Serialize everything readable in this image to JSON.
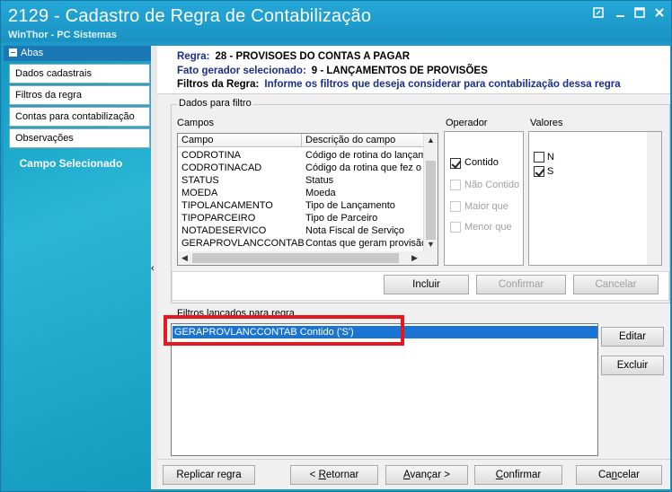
{
  "window": {
    "title": "2129 - Cadastro de Regra de Contabilização",
    "subtitle": "WinThor - PC Sistemas"
  },
  "sidebar": {
    "header": "Abas",
    "tabs": [
      {
        "label": "Dados cadastrais"
      },
      {
        "label": "Filtros da regra"
      },
      {
        "label": "Contas para contabilização"
      },
      {
        "label": "Observações"
      }
    ],
    "selected_field_label": "Campo Selecionado"
  },
  "header": {
    "regra_label": "Regra:",
    "regra_value": "28 - PROVISOES DO CONTAS A PAGAR",
    "fato_label": "Fato gerador selecionado:",
    "fato_value": "9 - LANÇAMENTOS DE PROVISÕES",
    "filtros_label": "Filtros da Regra:",
    "filtros_value": "Informe os filtros que deseja considerar para contabilização dessa regra"
  },
  "dados_filtro": {
    "legend": "Dados para filtro",
    "campos_label": "Campos",
    "operador_label": "Operador",
    "valores_label": "Valores",
    "columns": [
      "Campo",
      "Descrição do campo"
    ],
    "rows": [
      [
        "CODROTINA",
        "Código de rotina do lançam"
      ],
      [
        "CODROTINACAD",
        "Código da rotina que fez o"
      ],
      [
        "STATUS",
        "Status"
      ],
      [
        "MOEDA",
        "Moeda"
      ],
      [
        "TIPOLANCAMENTO",
        "Tipo de Lançamento"
      ],
      [
        "TIPOPARCEIRO",
        "Tipo de Parceiro"
      ],
      [
        "NOTADESERVICO",
        "Nota Fiscal de Serviço"
      ],
      [
        "GERAPROVLANCCONTAB",
        "Contas que geram provisão"
      ]
    ],
    "operators": [
      {
        "label": "Contido",
        "checked": true,
        "enabled": true
      },
      {
        "label": "Não Contido",
        "checked": false,
        "enabled": false
      },
      {
        "label": "Maior que",
        "checked": false,
        "enabled": false
      },
      {
        "label": "Menor que",
        "checked": false,
        "enabled": false
      }
    ],
    "values": [
      {
        "label": "N",
        "checked": false
      },
      {
        "label": "S",
        "checked": true
      }
    ],
    "incluir": "Incluir",
    "confirmar": "Confirmar",
    "cancelar": "Cancelar"
  },
  "filtros_lancados": {
    "legend": "Filtros lançados para regra",
    "items": [
      "GERAPROVLANCCONTAB Contido ('S')"
    ],
    "editar": "Editar",
    "excluir": "Excluir"
  },
  "footer": {
    "replicar": "Replicar regra",
    "retornar_pre": "< ",
    "retornar_u": "R",
    "retornar_post": "etornar",
    "avancar_pre": "",
    "avancar_u": "A",
    "avancar_post": "vançar >",
    "confirmar_u": "C",
    "confirmar_post": "onfirmar",
    "cancelar_pre": "Ca",
    "cancelar_u": "n",
    "cancelar_post": "celar"
  },
  "colors": {
    "title_bg": "#1f9fd0",
    "header_text": "#1a2e8c",
    "selection": "#1a74d4",
    "highlight": "#e8161d"
  },
  "icons": [
    "restore-icon",
    "maximize-icon",
    "close-icon",
    "collapse-arrow-icon"
  ]
}
